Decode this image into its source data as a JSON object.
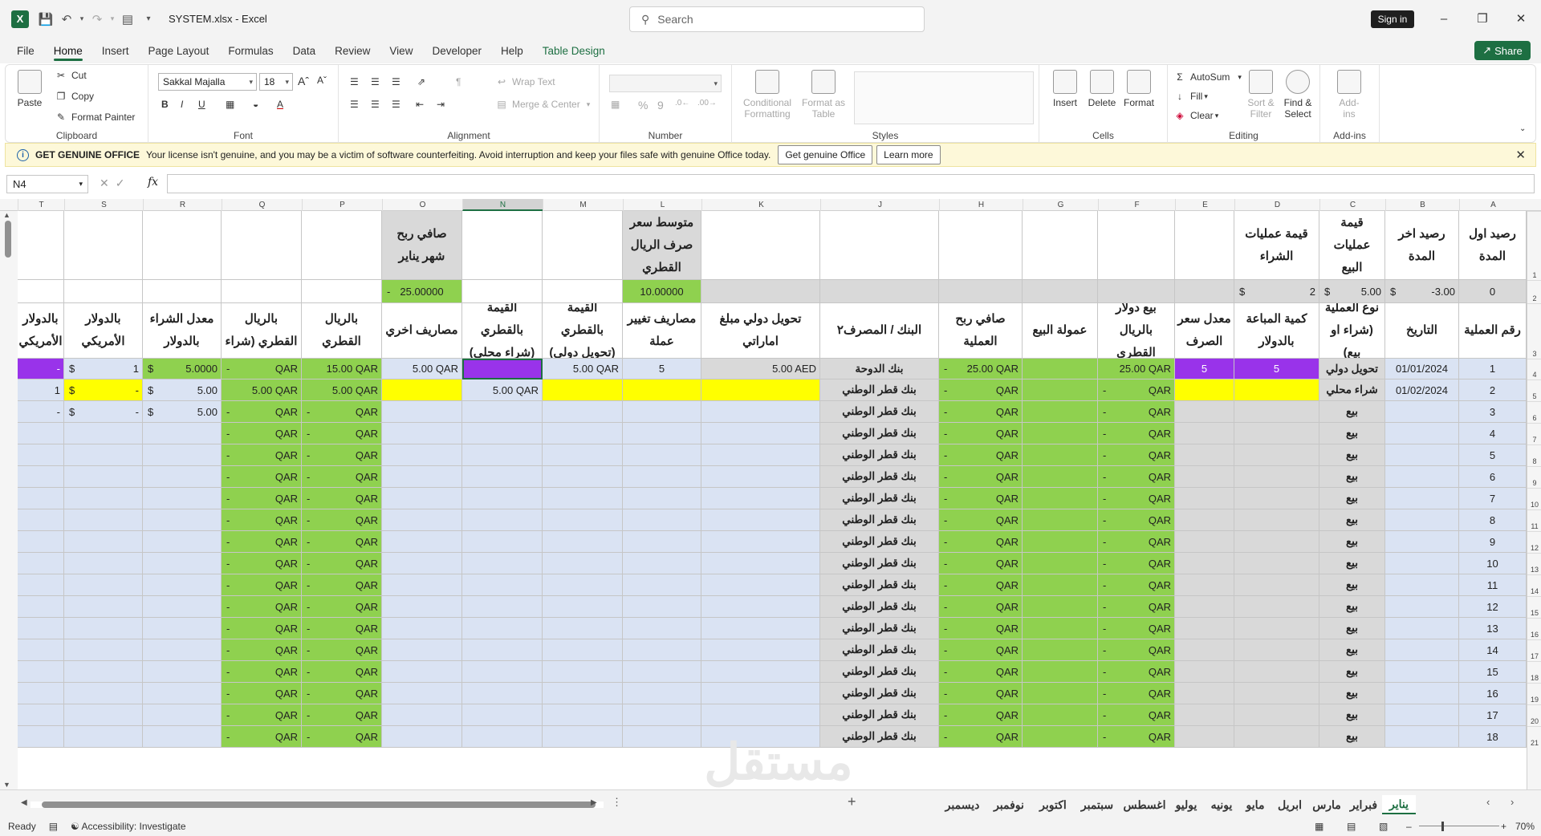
{
  "titlebar": {
    "filename": "SYSTEM.xlsx",
    "app_name": "Excel",
    "search_placeholder": "Search",
    "signin_label": "Sign in"
  },
  "menu": {
    "tabs": [
      "File",
      "Home",
      "Insert",
      "Page Layout",
      "Formulas",
      "Data",
      "Review",
      "View",
      "Developer",
      "Help",
      "Table Design"
    ],
    "active": "Home",
    "share_label": "Share"
  },
  "ribbon": {
    "clipboard": {
      "paste": "Paste",
      "cut": "Cut",
      "copy": "Copy",
      "format_painter": "Format Painter",
      "label": "Clipboard"
    },
    "font": {
      "name": "Sakkal Majalla",
      "size": "18",
      "label": "Font"
    },
    "alignment": {
      "wrap": "Wrap Text",
      "merge": "Merge & Center",
      "label": "Alignment"
    },
    "number": {
      "format": "",
      "label": "Number"
    },
    "styles": {
      "conditional": "Conditional Formatting",
      "format_table": "Format as Table",
      "label": "Styles"
    },
    "cells": {
      "insert": "Insert",
      "delete": "Delete",
      "format": "Format",
      "label": "Cells"
    },
    "editing": {
      "autosum": "AutoSum",
      "fill": "Fill",
      "clear": "Clear",
      "sort": "Sort & Filter",
      "find": "Find & Select",
      "label": "Editing"
    },
    "addins": {
      "addins": "Add-ins",
      "label": "Add-ins"
    }
  },
  "message_bar": {
    "title": "GET GENUINE OFFICE",
    "text": "Your license isn't genuine, and you may be a victim of software counterfeiting. Avoid interruption and keep your files safe with genuine Office today.",
    "btn1": "Get genuine Office",
    "btn2": "Learn more"
  },
  "formula_bar": {
    "name_box": "N4",
    "fx": "fx",
    "formula": ""
  },
  "columns": [
    "A",
    "B",
    "C",
    "D",
    "E",
    "F",
    "G",
    "H",
    "J",
    "K",
    "L",
    "M",
    "N",
    "O",
    "P",
    "Q",
    "R",
    "S",
    "T"
  ],
  "selected_column": "N",
  "row_numbers": [
    "1",
    "2",
    "3",
    "4",
    "5",
    "6",
    "7",
    "8",
    "9",
    "10",
    "11",
    "12",
    "13",
    "14",
    "15",
    "16",
    "17",
    "18",
    "19",
    "20",
    "21"
  ],
  "headers_row1": {
    "A": "رصيد اول المدة",
    "B": "رصيد اخر المدة",
    "C": "قيمة عمليات البيع",
    "D": "قيمة عمليات الشراء",
    "L": "متوسط سعر صرف الريال القطري",
    "O": "صافي ربح شهر يناير"
  },
  "row2": {
    "A": "0",
    "B_cur": "$",
    "B": "-3.00",
    "C_cur": "$",
    "C": "5.00",
    "D_cur": "$",
    "D": "2",
    "L": "10.00000",
    "O_dash": "-",
    "O": "25.00000"
  },
  "headers_row3": {
    "A": "رقم العملية",
    "B": "التاريخ",
    "C": "نوع العملية (شراء او بيع)",
    "D": "كمية المباعة بالدولار",
    "E": "معدل سعر الصرف",
    "F": "بيع دولار بالريال القطري",
    "G": "عمولة البيع",
    "H": "صافي ربح العملية",
    "J": "البنك / المصرف٢",
    "K": "تحويل دولي مبلغ اماراتي",
    "L": "مصاريف تغيير عملة",
    "M": "القيمة بالقطري (تحويل دولي)",
    "N": "القيمة بالقطري (شراء محلي)",
    "O": "مصاريف اخري",
    "P": "احمالي القيمة بالريال القطري (تحويل دولي)",
    "Q": "احمالي القيمة بالريال القطري (شراء محلي)",
    "R": "معدل الشراء بالدولار",
    "S": "اجمالي القيمة بالدولار الأمريكي (تحويل دولي)",
    "T": "اجمالي القيمة بالدولار الأمريكي (شراء محلي)"
  },
  "row4": {
    "A": "1",
    "B": "01/01/2024",
    "C": "تحويل دولي",
    "D": "5",
    "E": "5",
    "F": "25.00 QAR",
    "H_dash": "-",
    "H": "25.00 QAR",
    "J": "بنك الدوحة",
    "K": "5.00 AED",
    "L": "5",
    "M": "5.00 QAR",
    "O": "5.00 QAR",
    "P": "15.00 QAR",
    "Q_dash": "-",
    "Q": "QAR",
    "R_cur": "$",
    "R": "5.0000",
    "S_cur": "$",
    "S": "1",
    "T": "-"
  },
  "row5": {
    "A": "2",
    "B": "01/02/2024",
    "C": "شراء محلي",
    "F_dash": "-",
    "F": "QAR",
    "H_dash": "-",
    "H": "QAR",
    "J": "بنك قطر الوطني",
    "N": "5.00 QAR",
    "P": "5.00 QAR",
    "Q": "5.00 QAR",
    "R_cur": "$",
    "R": "5.00",
    "S_cur": "$",
    "S": "-",
    "T": "1"
  },
  "row6": {
    "A": "3",
    "C": "بيع",
    "F_dash": "-",
    "F": "QAR",
    "H_dash": "-",
    "H": "QAR",
    "J": "بنك قطر الوطني",
    "P_dash": "-",
    "P": "QAR",
    "Q_dash": "-",
    "Q": "QAR",
    "R_cur": "$",
    "R": "5.00",
    "S_cur": "$",
    "S": "-",
    "T": "-"
  },
  "repeat_rows": {
    "numbers": [
      "4",
      "5",
      "6",
      "7",
      "8",
      "9",
      "10",
      "11",
      "12",
      "13",
      "14",
      "15",
      "16",
      "17",
      "18"
    ],
    "type": "بيع",
    "bank": "بنك قطر الوطني",
    "dash": "-",
    "currency": "QAR"
  },
  "sheets": [
    "يناير",
    "فبراير",
    "مارس",
    "ابريل",
    "مايو",
    "يونيه",
    "يوليو",
    "اغسطس",
    "سبتمبر",
    "اكتوبر",
    "نوفمبر",
    "ديسمبر"
  ],
  "active_sheet": "يناير",
  "watermark": {
    "main": "مستقل",
    "sub": "mostaql.com"
  },
  "status": {
    "ready": "Ready",
    "accessibility": "Accessibility: Investigate",
    "zoom": "70%"
  }
}
